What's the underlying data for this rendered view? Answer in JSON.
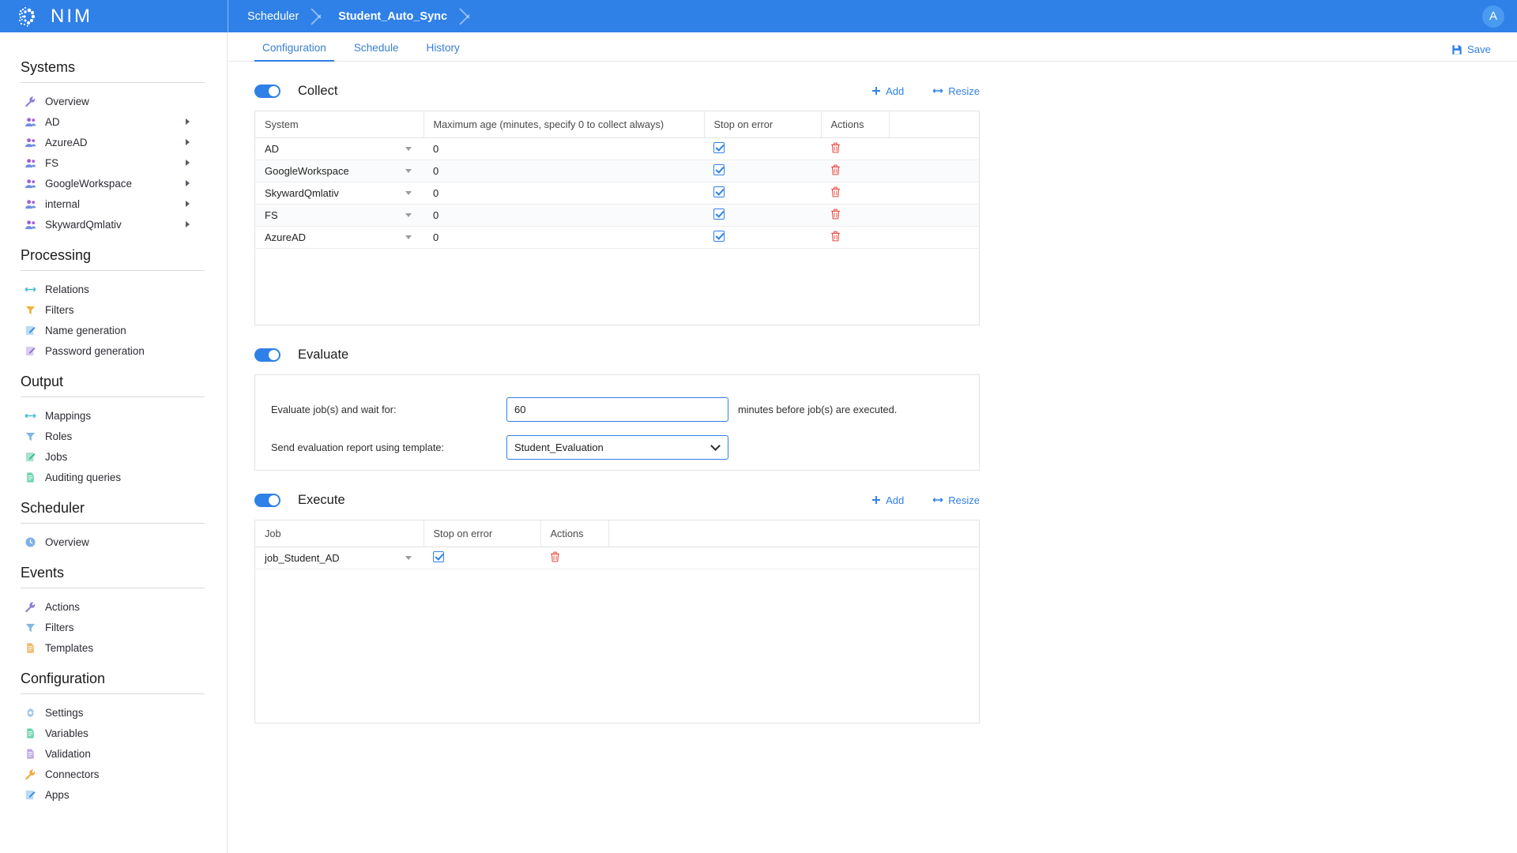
{
  "app": {
    "brand_name": "NIM",
    "logo_icon": "nim-logo-icon",
    "avatar_initial": "A"
  },
  "breadcrumb": {
    "items": [
      {
        "label": "Scheduler",
        "active": false
      },
      {
        "label": "Student_Auto_Sync",
        "active": true
      }
    ]
  },
  "sidebar": {
    "groups": [
      {
        "title": "Systems",
        "items": [
          {
            "label": "Overview",
            "icon": "wrench-icon",
            "has_arrow": false
          },
          {
            "label": "AD",
            "icon": "users-icon",
            "has_arrow": true
          },
          {
            "label": "AzureAD",
            "icon": "users-icon",
            "has_arrow": true
          },
          {
            "label": "FS",
            "icon": "users-icon",
            "has_arrow": true
          },
          {
            "label": "GoogleWorkspace",
            "icon": "users-icon",
            "has_arrow": true
          },
          {
            "label": "internal",
            "icon": "users-icon",
            "has_arrow": true
          },
          {
            "label": "SkywardQmlativ",
            "icon": "users-icon",
            "has_arrow": true
          }
        ]
      },
      {
        "title": "Processing",
        "items": [
          {
            "label": "Relations",
            "icon": "relations-icon",
            "has_arrow": false
          },
          {
            "label": "Filters",
            "icon": "funnel-icon",
            "has_arrow": false
          },
          {
            "label": "Name generation",
            "icon": "edit-document-icon",
            "has_arrow": false
          },
          {
            "label": "Password generation",
            "icon": "edit-document-icon",
            "has_arrow": false
          }
        ]
      },
      {
        "title": "Output",
        "items": [
          {
            "label": "Mappings",
            "icon": "relations-icon",
            "has_arrow": false
          },
          {
            "label": "Roles",
            "icon": "funnel-icon",
            "has_arrow": false
          },
          {
            "label": "Jobs",
            "icon": "edit-document-icon",
            "has_arrow": false
          },
          {
            "label": "Auditing queries",
            "icon": "document-icon",
            "has_arrow": false
          }
        ]
      },
      {
        "title": "Scheduler",
        "items": [
          {
            "label": "Overview",
            "icon": "clock-icon",
            "has_arrow": false
          }
        ]
      },
      {
        "title": "Events",
        "items": [
          {
            "label": "Actions",
            "icon": "wrench-icon",
            "has_arrow": false
          },
          {
            "label": "Filters",
            "icon": "funnel-icon",
            "has_arrow": false
          },
          {
            "label": "Templates",
            "icon": "document-icon",
            "has_arrow": false
          }
        ]
      },
      {
        "title": "Configuration",
        "items": [
          {
            "label": "Settings",
            "icon": "gear-icon",
            "has_arrow": false
          },
          {
            "label": "Variables",
            "icon": "document-icon",
            "has_arrow": false
          },
          {
            "label": "Validation",
            "icon": "document-icon",
            "has_arrow": false
          },
          {
            "label": "Connectors",
            "icon": "wrench-icon",
            "has_arrow": false
          },
          {
            "label": "Apps",
            "icon": "edit-document-icon",
            "has_arrow": false
          }
        ]
      }
    ]
  },
  "tabs": [
    {
      "label": "Configuration",
      "active": true
    },
    {
      "label": "Schedule",
      "active": false
    },
    {
      "label": "History",
      "active": false
    }
  ],
  "toolbar": {
    "save_label": "Save",
    "save_icon": "save-disk-icon"
  },
  "collect": {
    "title": "Collect",
    "enabled": true,
    "add_label": "Add",
    "resize_label": "Resize",
    "columns": [
      "System",
      "Maximum age (minutes, specify 0 to collect always)",
      "Stop on error",
      "Actions",
      ""
    ],
    "rows": [
      {
        "system": "AD",
        "max_age": "0",
        "stop_on_error": true
      },
      {
        "system": "GoogleWorkspace",
        "max_age": "0",
        "stop_on_error": true
      },
      {
        "system": "SkywardQmlativ",
        "max_age": "0",
        "stop_on_error": true
      },
      {
        "system": "FS",
        "max_age": "0",
        "stop_on_error": true
      },
      {
        "system": "AzureAD",
        "max_age": "0",
        "stop_on_error": true
      }
    ]
  },
  "evaluate": {
    "title": "Evaluate",
    "enabled": true,
    "wait_label": "Evaluate job(s) and wait for:",
    "wait_value": "60",
    "wait_suffix": "minutes before job(s) are executed.",
    "template_label": "Send evaluation report using template:",
    "template_value": "Student_Evaluation"
  },
  "execute": {
    "title": "Execute",
    "enabled": true,
    "add_label": "Add",
    "resize_label": "Resize",
    "columns": [
      "Job",
      "Stop on error",
      "Actions",
      ""
    ],
    "rows": [
      {
        "job": "job_Student_AD",
        "stop_on_error": true
      }
    ]
  },
  "colors": {
    "brand_blue": "#2f80e7",
    "link_blue": "#3a7fd5",
    "delete_red": "#e8453c",
    "avatar_blue": "#4a9bf0"
  }
}
